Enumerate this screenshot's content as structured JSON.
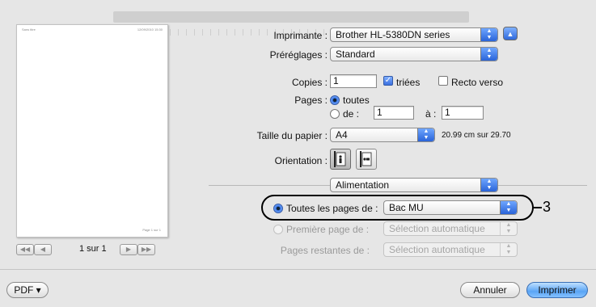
{
  "preview": {
    "header_left": "Sans titre",
    "header_right": "12/09/2010 15:30",
    "footer": "Page 1 sur 1",
    "page_indicator": "1 sur 1",
    "first_btn": "◀◀",
    "prev_btn": "◀",
    "next_btn": "▶",
    "last_btn": "▶▶"
  },
  "printer": {
    "label": "Imprimante :",
    "value": "Brother HL-5380DN series",
    "toggle_icon": "disclosure-up-icon"
  },
  "presets": {
    "label": "Préréglages :",
    "value": "Standard"
  },
  "copies": {
    "label": "Copies :",
    "value": "1",
    "collated_label": "triées",
    "collated": true,
    "duplex_label": "Recto verso",
    "duplex": false
  },
  "pages": {
    "label": "Pages :",
    "all_label": "toutes",
    "range_label": "de :",
    "from": "1",
    "to_label": "à :",
    "to": "1"
  },
  "paper_size": {
    "label": "Taille du papier :",
    "value": "A4",
    "dimensions": "20.99 cm sur 29.70"
  },
  "orientation": {
    "label": "Orientation :"
  },
  "section": {
    "value": "Alimentation"
  },
  "feed": {
    "all_pages_label": "Toutes les pages de :",
    "all_pages_value": "Bac MU",
    "first_page_label": "Première page de :",
    "first_page_value": "Sélection automatique",
    "remaining_label": "Pages restantes de :",
    "remaining_value": "Sélection automatique"
  },
  "callout": {
    "number": "3"
  },
  "footer": {
    "pdf_label": "PDF ▾",
    "cancel_label": "Annuler",
    "print_label": "Imprimer"
  },
  "colors": {
    "accent": "#3a70e0",
    "callout": "#000000"
  }
}
